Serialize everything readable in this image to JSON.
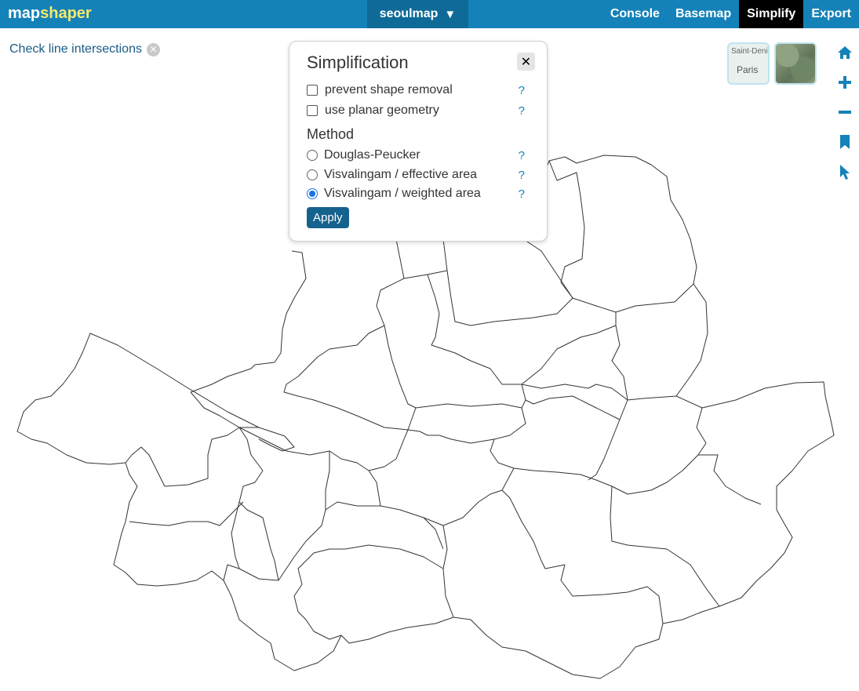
{
  "app": {
    "logo_part1": "map",
    "logo_part2": "shaper",
    "layer_name": "seoulmap",
    "layer_caret": "▼"
  },
  "nav": {
    "items": [
      {
        "label": "Console",
        "active": false
      },
      {
        "label": "Basemap",
        "active": false
      },
      {
        "label": "Simplify",
        "active": true
      },
      {
        "label": "Export",
        "active": false
      }
    ]
  },
  "intersections": {
    "label": "Check line intersections",
    "close_glyph": "✕"
  },
  "basemaps": {
    "streets_place": "Saint-Deni",
    "streets_city": "Paris"
  },
  "tools": [
    "home-icon",
    "zoom-in-icon",
    "zoom-out-icon",
    "bookmark-icon",
    "pointer-icon"
  ],
  "simplify": {
    "title": "Simplification",
    "close_glyph": "✕",
    "options": [
      {
        "label": "prevent shape removal",
        "checked": false,
        "help": "?"
      },
      {
        "label": "use planar geometry",
        "checked": false,
        "help": "?"
      }
    ],
    "method_heading": "Method",
    "methods": [
      {
        "label": "Douglas-Peucker",
        "selected": false,
        "help": "?"
      },
      {
        "label": "Visvalingam / effective area",
        "selected": false,
        "help": "?"
      },
      {
        "label": "Visvalingam / weighted area",
        "selected": true,
        "help": "?"
      }
    ],
    "apply_label": "Apply"
  },
  "colors": {
    "topbar": "#1482b8",
    "active_tab": "#000000",
    "accent": "#1a73e8",
    "map_line": "#333333"
  }
}
